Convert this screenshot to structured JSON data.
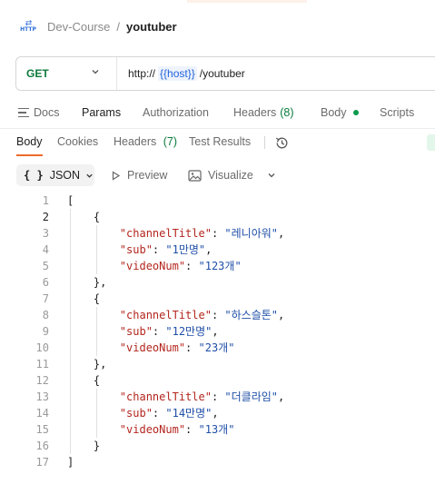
{
  "breadcrumb": {
    "icon": "http-request-icon",
    "icon_text": "HTTP",
    "parent": "Dev-Course",
    "separator": "/",
    "current": "youtuber"
  },
  "request": {
    "method": "GET",
    "url_prefix": "http://",
    "url_variable": "{{host}}",
    "url_suffix": "/youtuber"
  },
  "request_tabs": {
    "docs": "Docs",
    "params": "Params",
    "authorization": "Authorization",
    "headers": "Headers",
    "headers_count": "(8)",
    "body": "Body",
    "scripts": "Scripts",
    "active": "Params"
  },
  "response_tabs": {
    "body": "Body",
    "cookies": "Cookies",
    "headers": "Headers",
    "headers_count": "(7)",
    "test_results": "Test Results",
    "active": "Body"
  },
  "toolbar": {
    "format_braces": "{ }",
    "format": "JSON",
    "preview": "Preview",
    "visualize": "Visualize"
  },
  "colors": {
    "method_green": "#0b7a3b",
    "variable_blue": "#1f63d8",
    "json_key": "#b3261e",
    "json_string": "#1f4fa8",
    "active_tab_underline": "#ee6a2b"
  },
  "response_body": {
    "current_line": 2,
    "lines": [
      "[",
      "    {",
      "        \"channelTitle\": \"레니아워\",",
      "        \"sub\": \"1만명\",",
      "        \"videoNum\": \"123개\"",
      "    },",
      "    {",
      "        \"channelTitle\": \"하스슬톤\",",
      "        \"sub\": \"12만명\",",
      "        \"videoNum\": \"23개\"",
      "    },",
      "    {",
      "        \"channelTitle\": \"더클라임\",",
      "        \"sub\": \"14만명\",",
      "        \"videoNum\": \"13개\"",
      "    }",
      "]"
    ]
  }
}
